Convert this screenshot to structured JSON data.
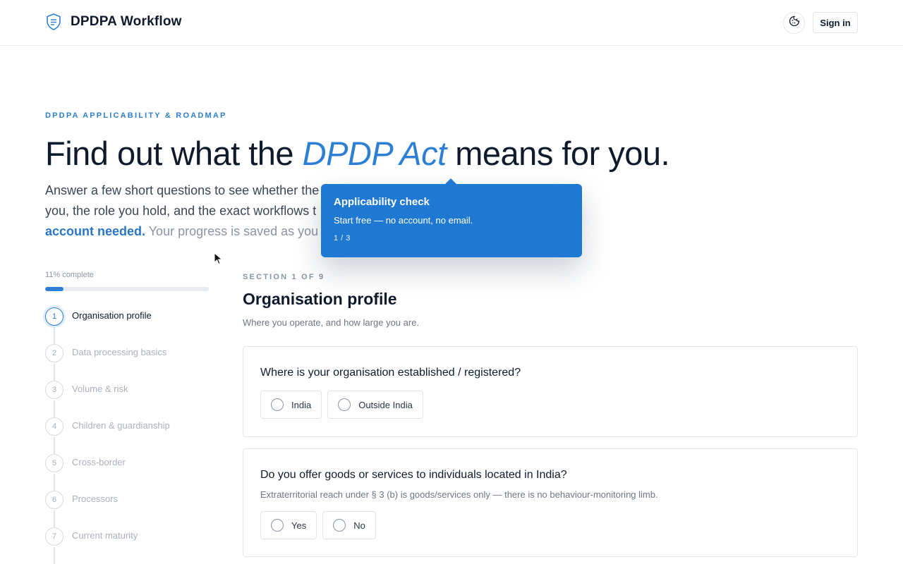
{
  "header": {
    "brand_name": "DPDPA Workflow",
    "logo_icon": "shield-document-icon",
    "cookie_icon": "cookie-icon",
    "signin_label": "Sign in"
  },
  "hero": {
    "eyebrow": "DPDPA APPLICABILITY & ROADMAP",
    "headline_before": "Find out what the ",
    "headline_accent": "DPDP Act",
    "headline_after": " means for you.",
    "lede_part1": "Answer a few short questions to see whether the",
    "lede_part2": "you, the role you hold, and the exact workflows t",
    "lede_strong": "account needed.",
    "lede_muted": " Your progress is saved as you g"
  },
  "tooltip": {
    "title": "Applicability check",
    "body": "Start free — no account, no email.",
    "step": "1 / 3"
  },
  "progress": {
    "label": "11% complete",
    "fraction": 0.11
  },
  "steps": [
    {
      "number": "1",
      "label": "Organisation profile",
      "active": true
    },
    {
      "number": "2",
      "label": "Data processing basics",
      "active": false
    },
    {
      "number": "3",
      "label": "Volume & risk",
      "active": false
    },
    {
      "number": "4",
      "label": "Children & guardianship",
      "active": false
    },
    {
      "number": "5",
      "label": "Cross-border",
      "active": false
    },
    {
      "number": "6",
      "label": "Processors",
      "active": false
    },
    {
      "number": "7",
      "label": "Current maturity",
      "active": false
    }
  ],
  "section": {
    "eyebrow": "SECTION 1 OF 9",
    "title": "Organisation profile",
    "subtitle": "Where you operate, and how large you are."
  },
  "questions": [
    {
      "question": "Where is your organisation established / registered?",
      "help": "",
      "options": [
        "India",
        "Outside India"
      ]
    },
    {
      "question": "Do you offer goods or services to individuals located in India?",
      "help": "Extraterritorial reach under § 3 (b) is goods/services only — there is no behaviour-monitoring limb.",
      "options": [
        "Yes",
        "No"
      ]
    }
  ],
  "colors": {
    "accent": "#2d7fd6",
    "tooltip_bg": "#1f78d1",
    "text_primary": "#0f1b2d",
    "text_muted": "#8a94a3"
  }
}
